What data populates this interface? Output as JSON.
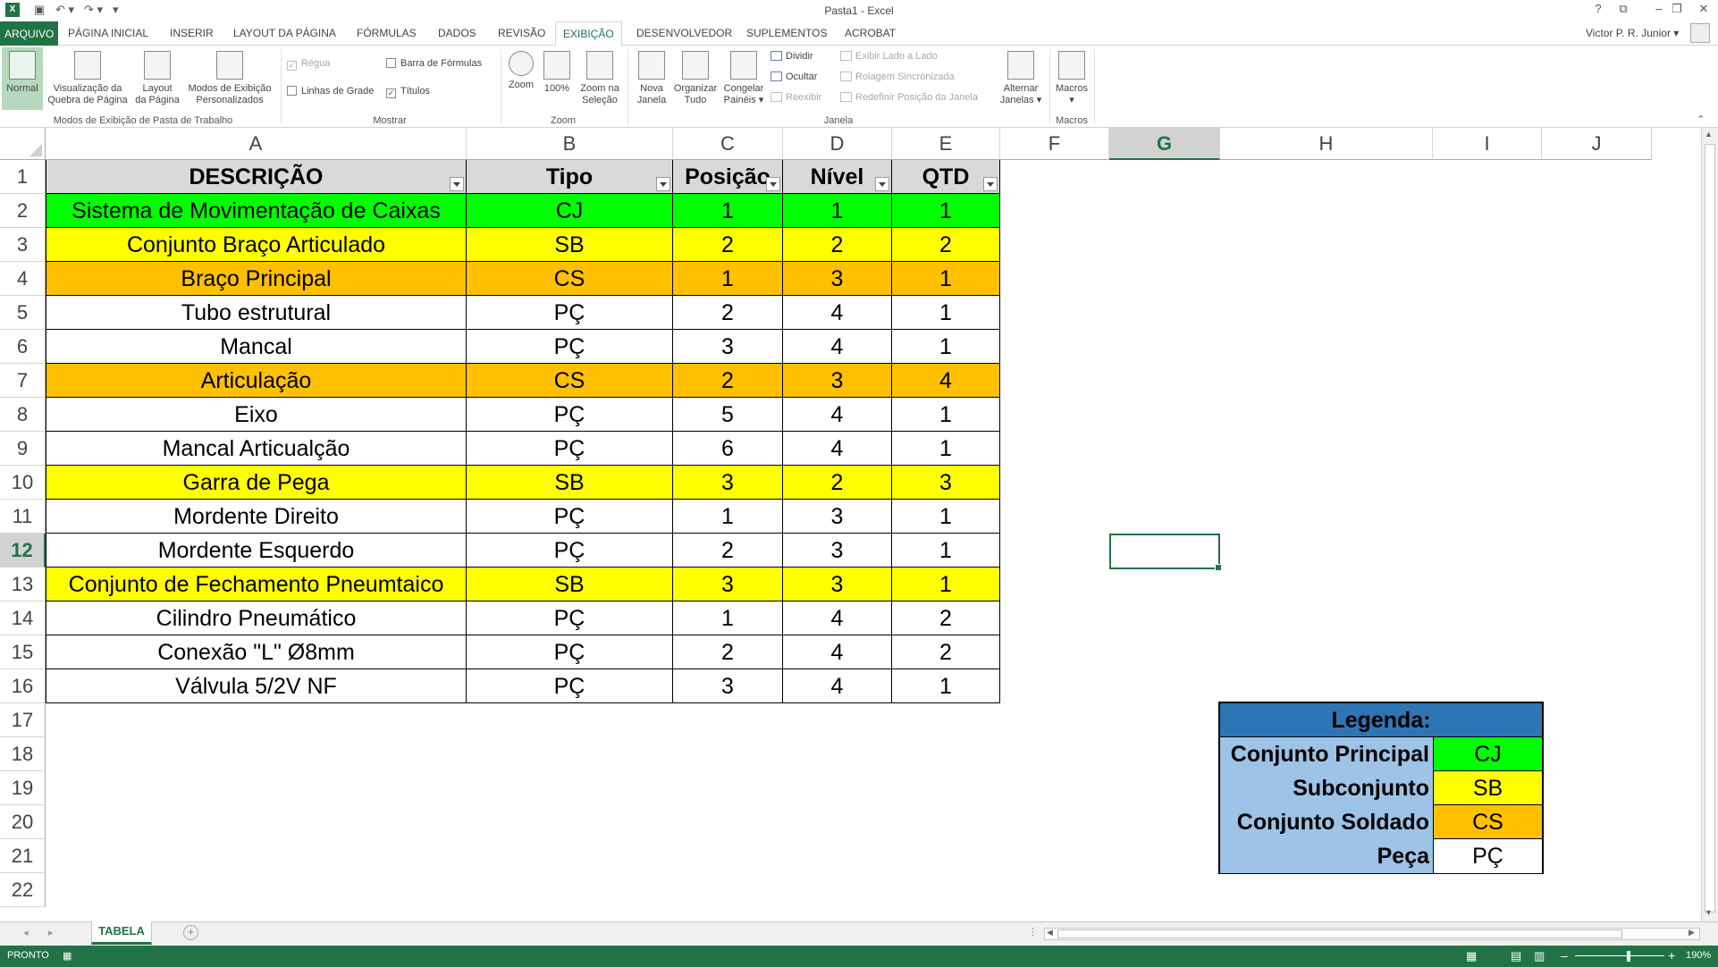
{
  "window": {
    "title": "Pasta1 - Excel",
    "help": "?",
    "controls": [
      "⧉",
      "–",
      "❐",
      "✕"
    ]
  },
  "ribbon_tabs": {
    "file": "ARQUIVO",
    "items": [
      "PÁGINA INICIAL",
      "INSERIR",
      "LAYOUT DA PÁGINA",
      "FÓRMULAS",
      "DADOS",
      "REVISÃO",
      "EXIBIÇÃO",
      "DESENVOLVEDOR",
      "SUPLEMENTOS",
      "ACROBAT"
    ],
    "active": "EXIBIÇÃO",
    "user": "Victor P. R. Junior ▾"
  },
  "ribbon": {
    "views": {
      "normal": "Normal",
      "page_break_1": "Visualização da",
      "page_break_2": "Quebra de Página",
      "page_layout_1": "Layout",
      "page_layout_2": "da Página",
      "custom_1": "Modos de Exibição",
      "custom_2": "Personalizados",
      "group_label": "Modos de Exibição de Pasta de Trabalho"
    },
    "show": {
      "ruler": "Régua",
      "formula_bar": "Barra de Fórmulas",
      "gridlines": "Linhas de Grade",
      "headings": "Títulos",
      "group_label": "Mostrar"
    },
    "zoom": {
      "zoom": "Zoom",
      "hundred": "100%",
      "zoom_sel_1": "Zoom na",
      "zoom_sel_2": "Seleção",
      "group_label": "Zoom"
    },
    "window": {
      "new_1": "Nova",
      "new_2": "Janela",
      "arrange_1": "Organizar",
      "arrange_2": "Tudo",
      "freeze_1": "Congelar",
      "freeze_2": "Painéis ▾",
      "split": "Dividir",
      "hide": "Ocultar",
      "unhide": "Reexibir",
      "side_by_side": "Exibir Lado a Lado",
      "sync_scroll": "Rolagem Sincronizada",
      "reset_pos": "Redefinir Posição da Janela",
      "switch_1": "Alternar",
      "switch_2": "Janelas ▾",
      "group_label": "Janela"
    },
    "macros": {
      "macros": "Macros",
      "arrow": "▾",
      "group_label": "Macros"
    }
  },
  "columns": [
    "A",
    "B",
    "C",
    "D",
    "E",
    "F",
    "G",
    "H",
    "I",
    "J"
  ],
  "rows": [
    "1",
    "2",
    "3",
    "4",
    "5",
    "6",
    "7",
    "8",
    "9",
    "10",
    "11",
    "12",
    "13",
    "14",
    "15",
    "16",
    "17",
    "18",
    "19",
    "20",
    "21",
    "22"
  ],
  "selected": {
    "column": "G",
    "row": "12"
  },
  "table": {
    "headers": [
      "DESCRIÇÃO",
      "Tipo",
      "Posição",
      "Nível",
      "QTD"
    ],
    "rows": [
      {
        "desc": "Sistema de Movimentação de Caixas",
        "tipo": "CJ",
        "pos": "1",
        "nivel": "1",
        "qtd": "1",
        "color": "#00ff00"
      },
      {
        "desc": "Conjunto Braço Articulado",
        "tipo": "SB",
        "pos": "2",
        "nivel": "2",
        "qtd": "2",
        "color": "#ffff00"
      },
      {
        "desc": "Braço Principal",
        "tipo": "CS",
        "pos": "1",
        "nivel": "3",
        "qtd": "1",
        "color": "#ffc000"
      },
      {
        "desc": "Tubo estrutural",
        "tipo": "PÇ",
        "pos": "2",
        "nivel": "4",
        "qtd": "1",
        "color": "#ffffff"
      },
      {
        "desc": "Mancal",
        "tipo": "PÇ",
        "pos": "3",
        "nivel": "4",
        "qtd": "1",
        "color": "#ffffff"
      },
      {
        "desc": "Articulação",
        "tipo": "CS",
        "pos": "2",
        "nivel": "3",
        "qtd": "4",
        "color": "#ffc000"
      },
      {
        "desc": "Eixo",
        "tipo": "PÇ",
        "pos": "5",
        "nivel": "4",
        "qtd": "1",
        "color": "#ffffff"
      },
      {
        "desc": "Mancal Articualção",
        "tipo": "PÇ",
        "pos": "6",
        "nivel": "4",
        "qtd": "1",
        "color": "#ffffff"
      },
      {
        "desc": "Garra de Pega",
        "tipo": "SB",
        "pos": "3",
        "nivel": "2",
        "qtd": "3",
        "color": "#ffff00"
      },
      {
        "desc": "Mordente Direito",
        "tipo": "PÇ",
        "pos": "1",
        "nivel": "3",
        "qtd": "1",
        "color": "#ffffff"
      },
      {
        "desc": "Mordente Esquerdo",
        "tipo": "PÇ",
        "pos": "2",
        "nivel": "3",
        "qtd": "1",
        "color": "#ffffff"
      },
      {
        "desc": "Conjunto de Fechamento Pneumtaico",
        "tipo": "SB",
        "pos": "3",
        "nivel": "3",
        "qtd": "1",
        "color": "#ffff00"
      },
      {
        "desc": "Cilindro Pneumático",
        "tipo": "PÇ",
        "pos": "1",
        "nivel": "4",
        "qtd": "2",
        "color": "#ffffff"
      },
      {
        "desc": "Conexão \"L\" Ø8mm",
        "tipo": "PÇ",
        "pos": "2",
        "nivel": "4",
        "qtd": "2",
        "color": "#ffffff"
      },
      {
        "desc": "Válvula 5/2V NF",
        "tipo": "PÇ",
        "pos": "3",
        "nivel": "4",
        "qtd": "1",
        "color": "#ffffff"
      }
    ]
  },
  "legend": {
    "title": "Legenda:",
    "title_color": "#2e75b6",
    "label_bg": "#9dc3e6",
    "items": [
      {
        "label": "Conjunto Principal",
        "code": "CJ",
        "color": "#00ff00"
      },
      {
        "label": "Subconjunto",
        "code": "SB",
        "color": "#ffff00"
      },
      {
        "label": "Conjunto Soldado",
        "code": "CS",
        "color": "#ffc000"
      },
      {
        "label": "Peça",
        "code": "PÇ",
        "color": "#ffffff"
      }
    ]
  },
  "sheets": {
    "active": "TABELA",
    "add": "+"
  },
  "status": {
    "ready": "PRONTO",
    "zoom": "190%"
  },
  "colors": {
    "excel_green": "#217346"
  }
}
